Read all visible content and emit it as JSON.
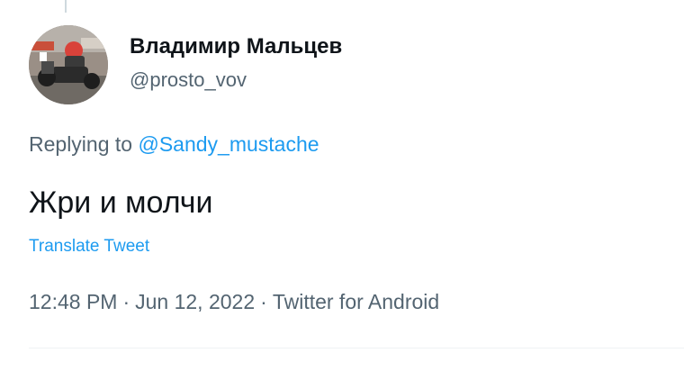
{
  "author": {
    "display_name": "Владимир Мальцев",
    "handle": "@prosto_vov"
  },
  "reply": {
    "prefix": "Replying to ",
    "mention": "@Sandy_mustache"
  },
  "tweet": {
    "text": "Жри и молчи",
    "translate_label": "Translate Tweet"
  },
  "meta": {
    "time": "12:48 PM",
    "separator": "·",
    "date": "Jun 12, 2022",
    "source": "Twitter for Android"
  },
  "colors": {
    "text": "#0f1419",
    "secondary": "#536471",
    "link": "#1d9bf0",
    "divider": "#eff3f4"
  }
}
